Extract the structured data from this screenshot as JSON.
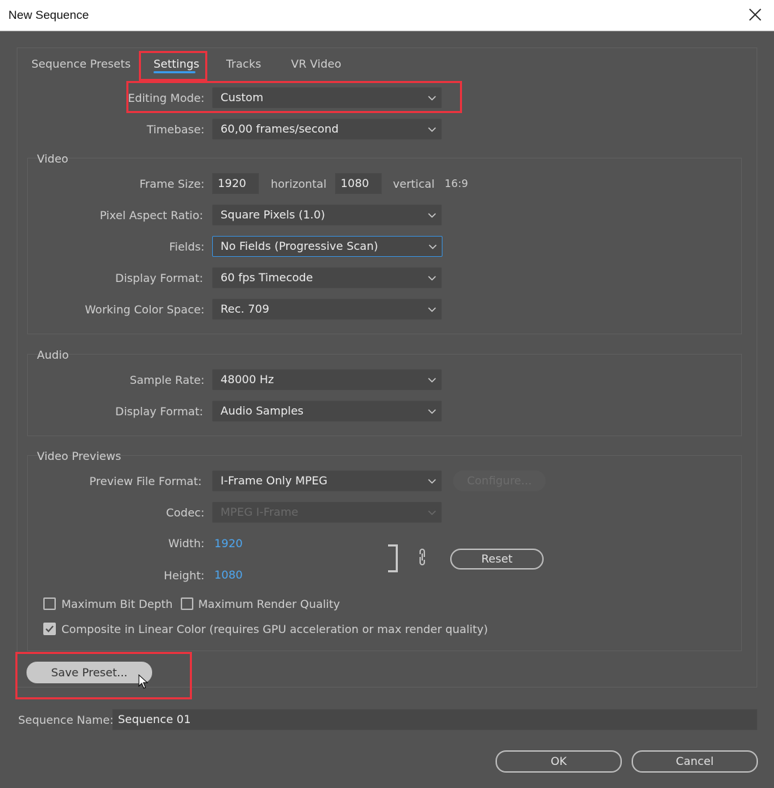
{
  "window": {
    "title": "New Sequence"
  },
  "tabs": [
    {
      "label": "Sequence Presets"
    },
    {
      "label": "Settings"
    },
    {
      "label": "Tracks"
    },
    {
      "label": "VR Video"
    }
  ],
  "general": {
    "editing_mode": {
      "label": "Editing Mode:",
      "value": "Custom"
    },
    "timebase": {
      "label": "Timebase:",
      "value": "60,00  frames/second"
    }
  },
  "video": {
    "title": "Video",
    "frame_size": {
      "label": "Frame Size:",
      "horizontal": "1920",
      "horizontal_label": "horizontal",
      "vertical": "1080",
      "vertical_label": "vertical",
      "aspect": "16:9"
    },
    "pixel_aspect": {
      "label": "Pixel Aspect Ratio:",
      "value": "Square Pixels (1.0)"
    },
    "fields": {
      "label": "Fields:",
      "value": "No Fields (Progressive Scan)"
    },
    "display_format": {
      "label": "Display Format:",
      "value": "60 fps Timecode"
    },
    "color_space": {
      "label": "Working Color Space:",
      "value": "Rec. 709"
    }
  },
  "audio": {
    "title": "Audio",
    "sample_rate": {
      "label": "Sample Rate:",
      "value": "48000 Hz"
    },
    "display_format": {
      "label": "Display Format:",
      "value": "Audio Samples"
    }
  },
  "previews": {
    "title": "Video Previews",
    "file_format": {
      "label": "Preview File Format:",
      "value": "I-Frame Only MPEG"
    },
    "configure_label": "Configure...",
    "codec": {
      "label": "Codec:",
      "value": "MPEG I-Frame"
    },
    "width": {
      "label": "Width:",
      "value": "1920"
    },
    "height": {
      "label": "Height:",
      "value": "1080"
    },
    "reset_label": "Reset",
    "max_bit_depth": {
      "label": "Maximum Bit Depth",
      "checked": false
    },
    "max_render_quality": {
      "label": "Maximum Render Quality",
      "checked": false
    },
    "linear_color": {
      "label": "Composite in Linear Color (requires GPU acceleration or max render quality)",
      "checked": true
    }
  },
  "save_preset_label": "Save Preset...",
  "sequence_name": {
    "label": "Sequence Name:",
    "value": "Sequence 01"
  },
  "buttons": {
    "ok": "OK",
    "cancel": "Cancel"
  },
  "colors": {
    "highlight": "#e8343f",
    "accent": "#3b9bea",
    "link": "#4ea7f0",
    "background": "#535353"
  }
}
